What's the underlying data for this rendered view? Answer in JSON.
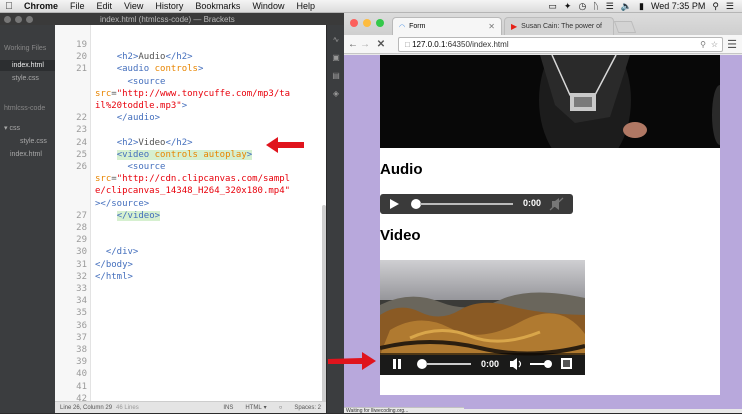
{
  "menubar": {
    "app": "Chrome",
    "items": [
      "File",
      "Edit",
      "View",
      "History",
      "Bookmarks",
      "Window",
      "Help"
    ],
    "clock": "Wed 7:35 PM"
  },
  "brackets": {
    "title": "index.html (htmlcss-code) — Brackets",
    "sidebar": {
      "working_files_label": "Working Files",
      "working_files": [
        "index.html",
        "style.css"
      ],
      "project_label": "htmlcss-code",
      "folder": "css",
      "folder_files": [
        "style.css"
      ],
      "root_files": [
        "index.html"
      ]
    },
    "code_lines": [
      {
        "n": "19",
        "parts": []
      },
      {
        "n": "20",
        "parts": [
          [
            "",
            "    "
          ],
          [
            "tag",
            "<h2>"
          ],
          [
            "",
            "Audio"
          ],
          [
            "tag",
            "</h2>"
          ]
        ]
      },
      {
        "n": "21",
        "parts": [
          [
            "",
            "    "
          ],
          [
            "tag",
            "<audio "
          ],
          [
            "attr",
            "controls"
          ],
          [
            "tag",
            ">"
          ]
        ]
      },
      {
        "n": "",
        "parts": [
          [
            "",
            "      "
          ],
          [
            "tag",
            "<source"
          ]
        ]
      },
      {
        "n": "",
        "parts": [
          [
            "attr",
            "src"
          ],
          [
            "",
            "="
          ],
          [
            "str",
            "\"http://www.tonycuffe.com/mp3/ta"
          ]
        ]
      },
      {
        "n": "",
        "parts": [
          [
            "str",
            "il%20toddle.mp3\""
          ],
          [
            "tag",
            ">"
          ]
        ]
      },
      {
        "n": "22",
        "parts": [
          [
            "",
            "    "
          ],
          [
            "tag",
            "</audio>"
          ]
        ]
      },
      {
        "n": "23",
        "parts": []
      },
      {
        "n": "24",
        "parts": [
          [
            "",
            "    "
          ],
          [
            "tag",
            "<h2>"
          ],
          [
            "",
            "Video"
          ],
          [
            "tag",
            "</h2>"
          ]
        ]
      },
      {
        "n": "25",
        "parts": [
          [
            "",
            "    "
          ],
          [
            "tag",
            "<video "
          ],
          [
            "attr",
            "controls autoplay"
          ],
          [
            "tag",
            ">"
          ]
        ],
        "hl": true
      },
      {
        "n": "26",
        "parts": [
          [
            "",
            "      "
          ],
          [
            "tag",
            "<source"
          ]
        ]
      },
      {
        "n": "",
        "parts": [
          [
            "attr",
            "src"
          ],
          [
            "",
            "="
          ],
          [
            "str",
            "\"http://cdn.clipcanvas.com/sampl"
          ]
        ]
      },
      {
        "n": "",
        "parts": [
          [
            "str",
            "e/clipcanvas_14348_H264_320x180.mp4\""
          ]
        ]
      },
      {
        "n": "",
        "parts": [
          [
            "tag",
            "></source>"
          ]
        ]
      },
      {
        "n": "27",
        "parts": [
          [
            "",
            "    "
          ],
          [
            "tag",
            "</video>"
          ]
        ],
        "hl": true
      },
      {
        "n": "28",
        "parts": []
      },
      {
        "n": "29",
        "parts": []
      },
      {
        "n": "30",
        "parts": [
          [
            "",
            "  "
          ],
          [
            "tag",
            "</div>"
          ]
        ]
      },
      {
        "n": "31",
        "parts": [
          [
            "tag",
            "</body>"
          ]
        ]
      },
      {
        "n": "32",
        "parts": [
          [
            "tag",
            "</html>"
          ]
        ]
      },
      {
        "n": "33",
        "parts": []
      },
      {
        "n": "34",
        "parts": []
      },
      {
        "n": "35",
        "parts": []
      },
      {
        "n": "36",
        "parts": []
      },
      {
        "n": "37",
        "parts": []
      },
      {
        "n": "38",
        "parts": []
      },
      {
        "n": "39",
        "parts": []
      },
      {
        "n": "40",
        "parts": []
      },
      {
        "n": "41",
        "parts": []
      },
      {
        "n": "42",
        "parts": []
      }
    ],
    "status": {
      "position": "Line 26, Column 29",
      "lines": "46 Lines",
      "mode": "INS",
      "language": "HTML",
      "spaces": "Spaces: 2"
    }
  },
  "chrome": {
    "tabs": [
      {
        "title": "Form",
        "active": true
      },
      {
        "title": "Susan Cain: The power of",
        "active": false
      }
    ],
    "url_host": "127.0.0.1",
    "url_rest": ":64350/index.html",
    "page": {
      "audio_heading": "Audio",
      "audio_time": "0:00",
      "video_heading": "Video",
      "video_time": "0:00"
    },
    "status_text": "Waiting for lliwecoding.org..."
  }
}
